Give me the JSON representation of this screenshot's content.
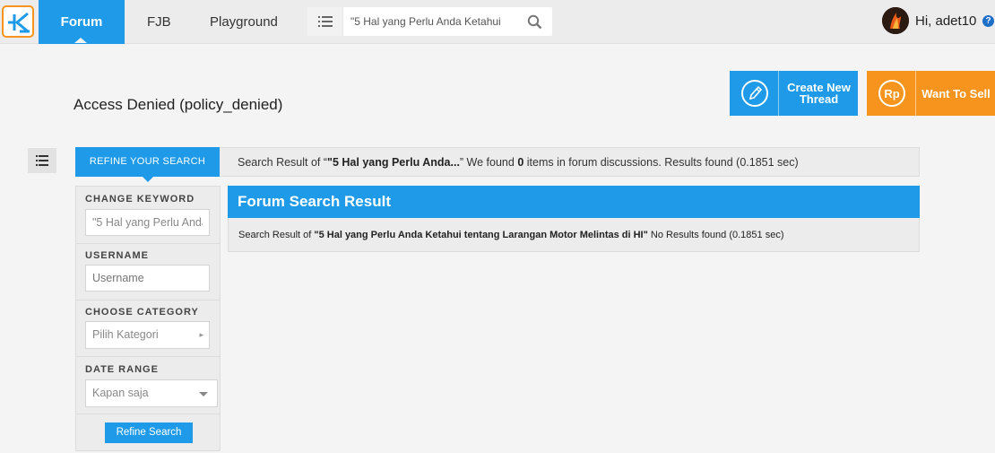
{
  "nav": {
    "forum": "Forum",
    "fjb": "FJB",
    "playground": "Playground",
    "search_value": "\"5 Hal yang Perlu Anda Ketahui",
    "greeting": "Hi, adet10",
    "help": "?"
  },
  "page": {
    "title": "Access Denied (policy_denied)"
  },
  "actions": {
    "create_thread": "Create New Thread",
    "sell": "Want To Sell"
  },
  "refine": {
    "tab_label": "REFINE YOUR SEARCH",
    "summary_prefix": "Search Result of “",
    "summary_query": "\"5 Hal yang Perlu Anda...",
    "summary_mid": "” We found ",
    "summary_count": "0",
    "summary_suffix": " items in forum discussions. Results found (0.1851 sec)"
  },
  "filters": {
    "keyword_label": "CHANGE KEYWORD",
    "keyword_value": "\"5 Hal yang Perlu Anda",
    "username_label": "USERNAME",
    "username_placeholder": "Username",
    "category_label": "CHOOSE CATEGORY",
    "category_value": "Pilih Kategori",
    "date_label": "DATE RANGE",
    "date_value": "Kapan saja",
    "refine_button": "Refine Search"
  },
  "results": {
    "heading": "Forum Search Result",
    "line_prefix": "Search Result of ",
    "line_query": "\"5 Hal yang Perlu Anda Ketahui tentang Larangan Motor Melintas di HI\"",
    "line_suffix": " No Results found (0.1851 sec)"
  },
  "colors": {
    "primary": "#1e9ae8",
    "accent": "#f7941d"
  }
}
